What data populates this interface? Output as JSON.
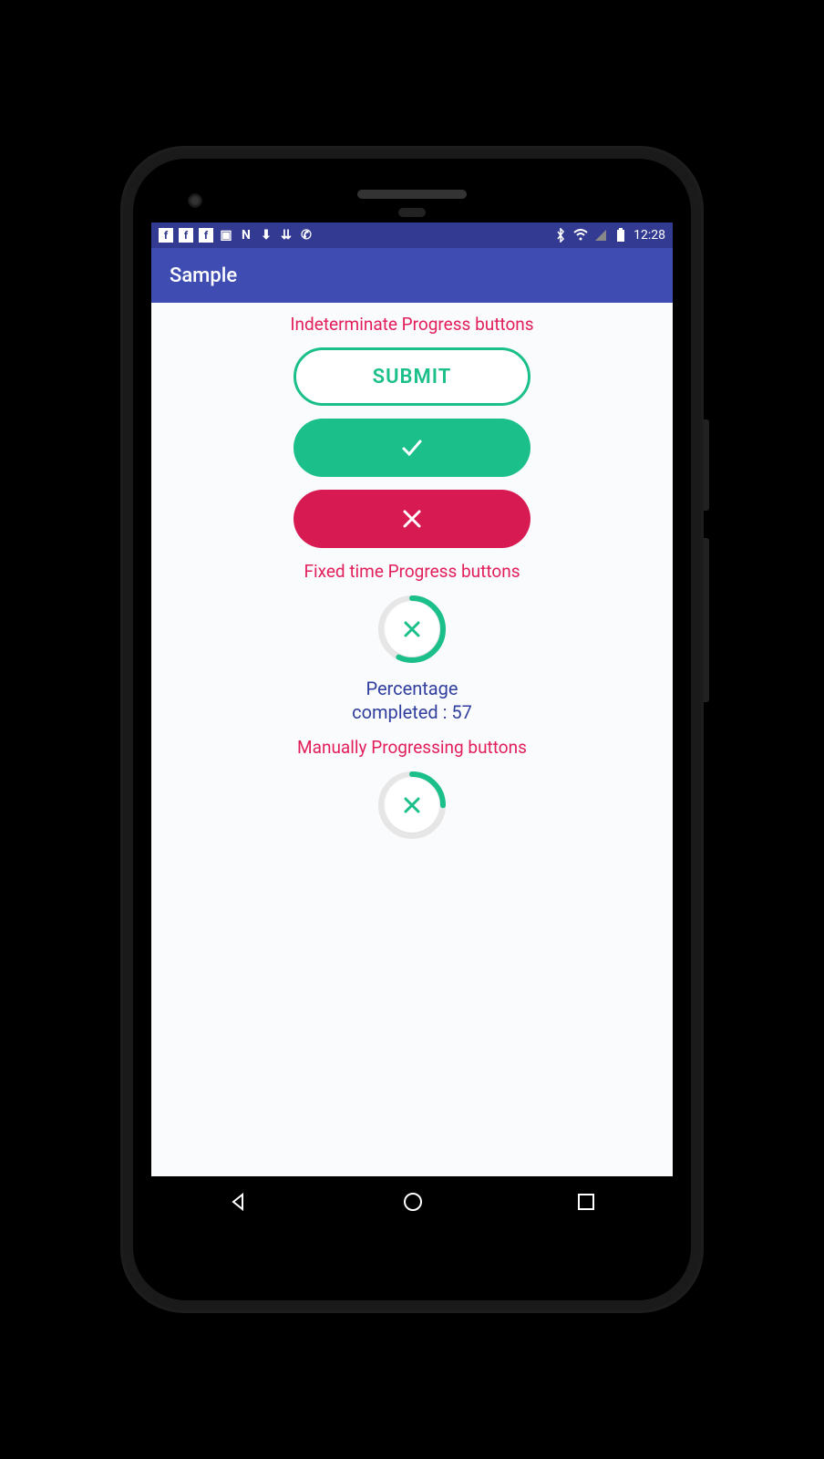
{
  "status": {
    "time": "12:28",
    "icons_left": [
      "facebook",
      "facebook",
      "facebook",
      "image",
      "n",
      "download",
      "update",
      "call"
    ],
    "icons_right": [
      "bluetooth",
      "wifi",
      "signal",
      "battery"
    ]
  },
  "app": {
    "title": "Sample"
  },
  "sections": {
    "indeterminate": {
      "title": "Indeterminate Progress buttons",
      "submit_label": "SUBMIT"
    },
    "fixed": {
      "title": "Fixed time Progress buttons",
      "percentage_label": "Percentage",
      "completed_label": "completed : ",
      "percentage_value": 57
    },
    "manual": {
      "title": "Manually Progressing buttons"
    }
  }
}
